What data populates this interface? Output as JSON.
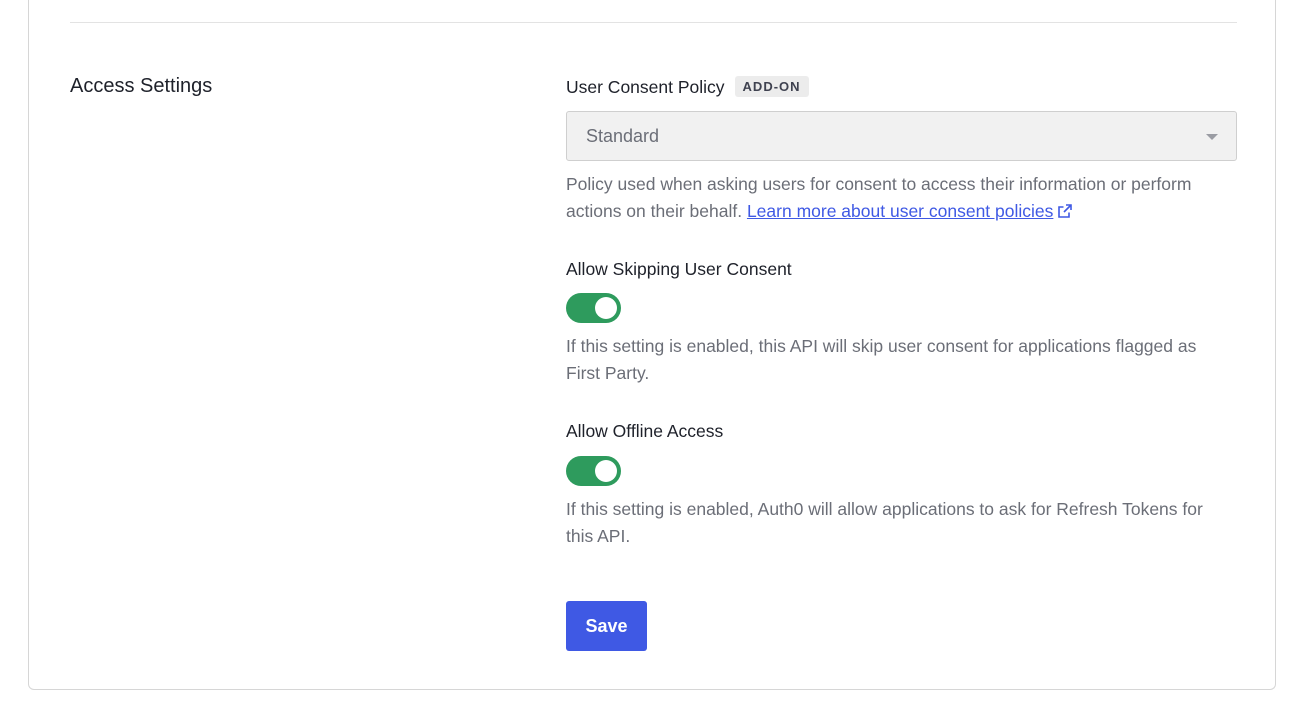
{
  "section": {
    "title": "Access Settings"
  },
  "consent_policy": {
    "label": "User Consent Policy",
    "badge": "ADD-ON",
    "selected": "Standard",
    "help_text": "Policy used when asking users for consent to access their information or perform actions on their behalf. ",
    "link_text": "Learn more about user consent policies",
    "link_icon": "external-link-icon"
  },
  "skip_consent": {
    "label": "Allow Skipping User Consent",
    "enabled": true,
    "help_text": "If this setting is enabled, this API will skip user consent for applications flagged as First Party."
  },
  "offline_access": {
    "label": "Allow Offline Access",
    "enabled": true,
    "help_text": "If this setting is enabled, Auth0 will allow applications to ask for Refresh Tokens for this API."
  },
  "actions": {
    "save_label": "Save"
  },
  "colors": {
    "toggle_on": "#2e9b5d",
    "primary": "#3f59e4"
  }
}
